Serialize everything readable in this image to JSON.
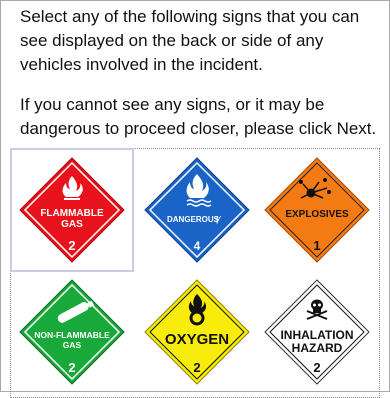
{
  "instructions": {
    "line1": "Select any of the following signs that you can see displayed on the back or side of any vehicles involved in the incident.",
    "line2": "If you cannot see any signs, or it may be dangerous to proceed closer, please click Next."
  },
  "signs": [
    {
      "label1": "FLAMMABLE",
      "label2": "GAS",
      "number": "2",
      "color": "#e8121c",
      "icon": "flame-icon"
    },
    {
      "label1": "DANGEROUS",
      "label2": "",
      "number": "4",
      "color": "#1a64c8",
      "icon": "flame-over-water-icon"
    },
    {
      "label1": "EXPLOSIVES",
      "label2": "",
      "number": "1",
      "color": "#f47a14",
      "icon": "explosion-icon"
    },
    {
      "label1": "NON-FLAMMABLE",
      "label2": "GAS",
      "number": "2",
      "color": "#19a83a",
      "icon": "gas-cylinder-icon"
    },
    {
      "label1": "OXYGEN",
      "label2": "",
      "number": "2",
      "color": "#f8ec0c",
      "icon": "flame-over-circle-icon"
    },
    {
      "label1": "INHALATION",
      "label2": "HAZARD",
      "number": "2",
      "color": "#ffffff",
      "icon": "skull-icon"
    }
  ]
}
